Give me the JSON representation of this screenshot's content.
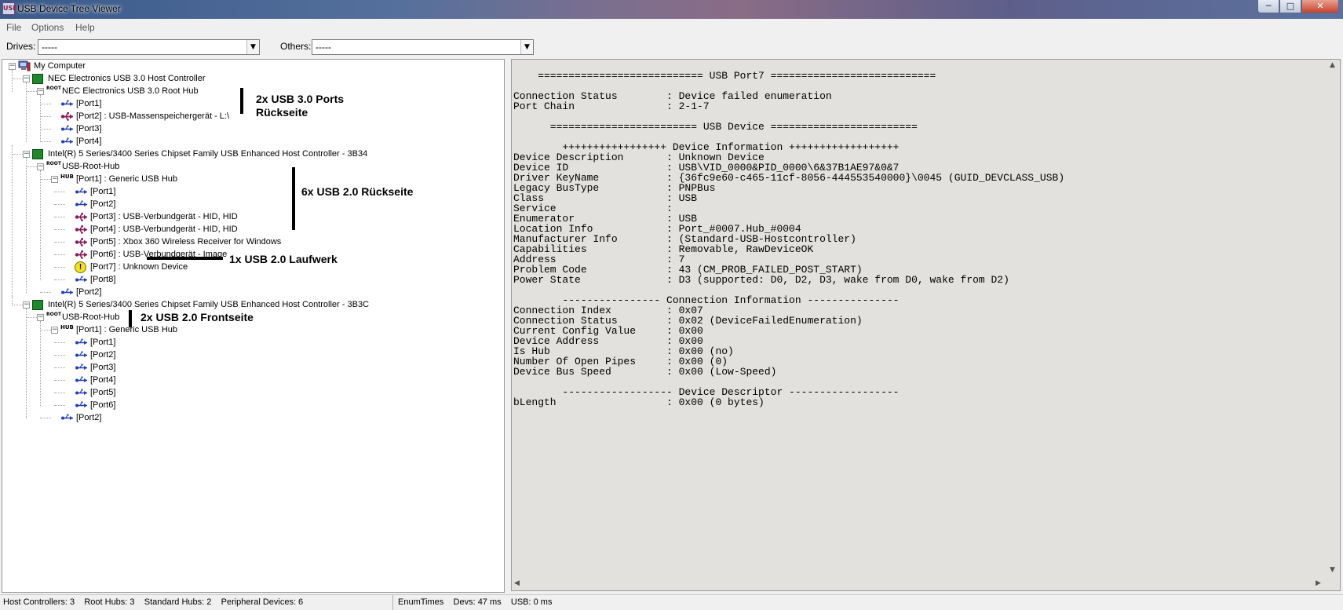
{
  "window": {
    "title": "USB Device Tree Viewer",
    "icon_text": "USB",
    "min": "─",
    "max": "□",
    "close": "✕"
  },
  "menu": [
    "File",
    "Options",
    "Help"
  ],
  "toolbar": {
    "drives_label": "Drives:",
    "drives_value": "-----",
    "others_label": "Others:",
    "others_value": "-----"
  },
  "tree": [
    {
      "text": "My Computer",
      "icon": "computer-icon"
    },
    {
      "text": "NEC Electronics USB 3.0 Host Controller",
      "icon": "host-controller-icon"
    },
    {
      "text": "NEC Electronics USB 3.0 Root Hub",
      "icon": "root-hub-icon"
    },
    {
      "text": "[Port1]",
      "icon": "usb-port-icon"
    },
    {
      "text": "[Port2] : USB-Massenspeichergerät - L:\\",
      "icon": "usb-device-icon"
    },
    {
      "text": "[Port3]",
      "icon": "usb-port-icon"
    },
    {
      "text": "[Port4]",
      "icon": "usb-port-icon"
    },
    {
      "text": "Intel(R) 5 Series/3400 Series Chipset Family USB Enhanced Host Controller - 3B34",
      "icon": "host-controller-icon"
    },
    {
      "text": "USB-Root-Hub",
      "icon": "root-hub-icon"
    },
    {
      "text": "[Port1] : Generic USB Hub",
      "icon": "hub-icon"
    },
    {
      "text": "[Port1]",
      "icon": "usb-port-icon"
    },
    {
      "text": "[Port2]",
      "icon": "usb-port-icon"
    },
    {
      "text": "[Port3] : USB-Verbundgerät - HID, HID",
      "icon": "usb-device-icon"
    },
    {
      "text": "[Port4] : USB-Verbundgerät - HID, HID",
      "icon": "usb-device-icon"
    },
    {
      "text": "[Port5] : Xbox 360 Wireless Receiver for Windows",
      "icon": "usb-device-icon"
    },
    {
      "text": "[Port6] : USB-Verbundgerät - Image",
      "icon": "usb-device-icon"
    },
    {
      "text": "[Port7] : Unknown Device",
      "icon": "warning-icon"
    },
    {
      "text": "[Port8]",
      "icon": "usb-port-icon"
    },
    {
      "text": "[Port2]",
      "icon": "usb-port-icon"
    },
    {
      "text": "Intel(R) 5 Series/3400 Series Chipset Family USB Enhanced Host Controller - 3B3C",
      "icon": "host-controller-icon"
    },
    {
      "text": "USB-Root-Hub",
      "icon": "root-hub-icon"
    },
    {
      "text": "[Port1] : Generic USB Hub",
      "icon": "hub-icon"
    },
    {
      "text": "[Port1]",
      "icon": "usb-port-icon"
    },
    {
      "text": "[Port2]",
      "icon": "usb-port-icon"
    },
    {
      "text": "[Port3]",
      "icon": "usb-port-icon"
    },
    {
      "text": "[Port4]",
      "icon": "usb-port-icon"
    },
    {
      "text": "[Port5]",
      "icon": "usb-port-icon"
    },
    {
      "text": "[Port6]",
      "icon": "usb-port-icon"
    },
    {
      "text": "[Port2]",
      "icon": "usb-port-icon"
    }
  ],
  "icon_labels": {
    "root": "ROOT",
    "hub": "HUB",
    "warning": "!"
  },
  "annotations": {
    "usb30_line1": "2x USB 3.0 Ports",
    "usb30_line2": "Rückseite",
    "usb20_back": "6x USB 2.0 Rückseite",
    "usb20_drive": "1x USB 2.0 Laufwerk",
    "usb20_front": "2x USB 2.0 Frontseite"
  },
  "detail": [
    "    =========================== USB Port7 ===========================",
    "",
    "Connection Status        : Device failed enumeration",
    "Port Chain               : 2-1-7",
    "",
    "      ======================== USB Device ========================",
    "",
    "        +++++++++++++++++ Device Information ++++++++++++++++++",
    "Device Description       : Unknown Device",
    "Device ID                : USB\\VID_0000&PID_0000\\6&37B1AE97&0&7",
    "Driver KeyName           : {36fc9e60-c465-11cf-8056-444553540000}\\0045 (GUID_DEVCLASS_USB)",
    "Legacy BusType           : PNPBus",
    "Class                    : USB",
    "Service                  :",
    "Enumerator               : USB",
    "Location Info            : Port_#0007.Hub_#0004",
    "Manufacturer Info        : (Standard-USB-Hostcontroller)",
    "Capabilities             : Removable, RawDeviceOK",
    "Address                  : 7",
    "Problem Code             : 43 (CM_PROB_FAILED_POST_START)",
    "Power State              : D3 (supported: D0, D2, D3, wake from D0, wake from D2)",
    "",
    "        ---------------- Connection Information ---------------",
    "Connection Index         : 0x07",
    "Connection Status        : 0x02 (DeviceFailedEnumeration)",
    "Current Config Value     : 0x00",
    "Device Address           : 0x00",
    "Is Hub                   : 0x00 (no)",
    "Number Of Open Pipes     : 0x00 (0)",
    "Device Bus Speed         : 0x00 (Low-Speed)",
    "",
    "        ------------------ Device Descriptor ------------------",
    "bLength                  : 0x00 (0 bytes)"
  ],
  "status": {
    "host_controllers": "Host Controllers: 3",
    "root_hubs": "Root Hubs: 3",
    "standard_hubs": "Standard Hubs: 2",
    "peripheral_devices": "Peripheral Devices: 6",
    "enum_times": "EnumTimes",
    "devs": "Devs: 47 ms",
    "usb": "USB: 0 ms"
  }
}
